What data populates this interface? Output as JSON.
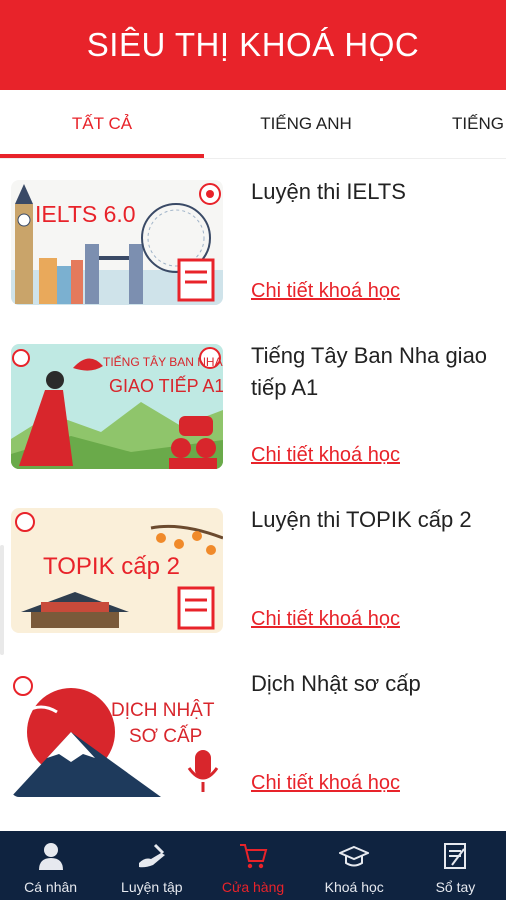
{
  "header": {
    "title": "SIÊU THỊ KHOÁ HỌC"
  },
  "tabs": [
    {
      "label": "TẤT CẢ",
      "active": true
    },
    {
      "label": "TIẾNG ANH",
      "active": false
    },
    {
      "label": "TIẾNG",
      "active": false
    }
  ],
  "courses": [
    {
      "title": "Luyện thi IELTS",
      "link": "Chi tiết khoá học",
      "thumb_text": [
        "IELTS 6.0"
      ]
    },
    {
      "title": "Tiếng Tây Ban Nha giao tiếp A1",
      "link": "Chi tiết khoá học",
      "thumb_text": [
        "TIẾNG TÂY BAN NHA",
        "GIAO TIẾP A1"
      ]
    },
    {
      "title": "Luyện thi TOPIK cấp 2",
      "link": "Chi tiết khoá học",
      "thumb_text": [
        "TOPIK cấp 2"
      ]
    },
    {
      "title": "Dịch Nhật sơ cấp",
      "link": "Chi tiết khoá học",
      "thumb_text": [
        "DỊCH NHẬT",
        "SƠ CẤP"
      ]
    }
  ],
  "bottom_nav": [
    {
      "label": "Cá nhân",
      "icon": "person-icon",
      "active": false
    },
    {
      "label": "Luyện tập",
      "icon": "hand-pen-icon",
      "active": false
    },
    {
      "label": "Cửa hàng",
      "icon": "cart-icon",
      "active": true
    },
    {
      "label": "Khoá học",
      "icon": "graduation-cap-icon",
      "active": false
    },
    {
      "label": "Sổ tay",
      "icon": "notebook-icon",
      "active": false
    }
  ],
  "colors": {
    "brand": "#e8232a",
    "nav_bg": "#0f2340",
    "nav_text": "#e6e9ef"
  }
}
